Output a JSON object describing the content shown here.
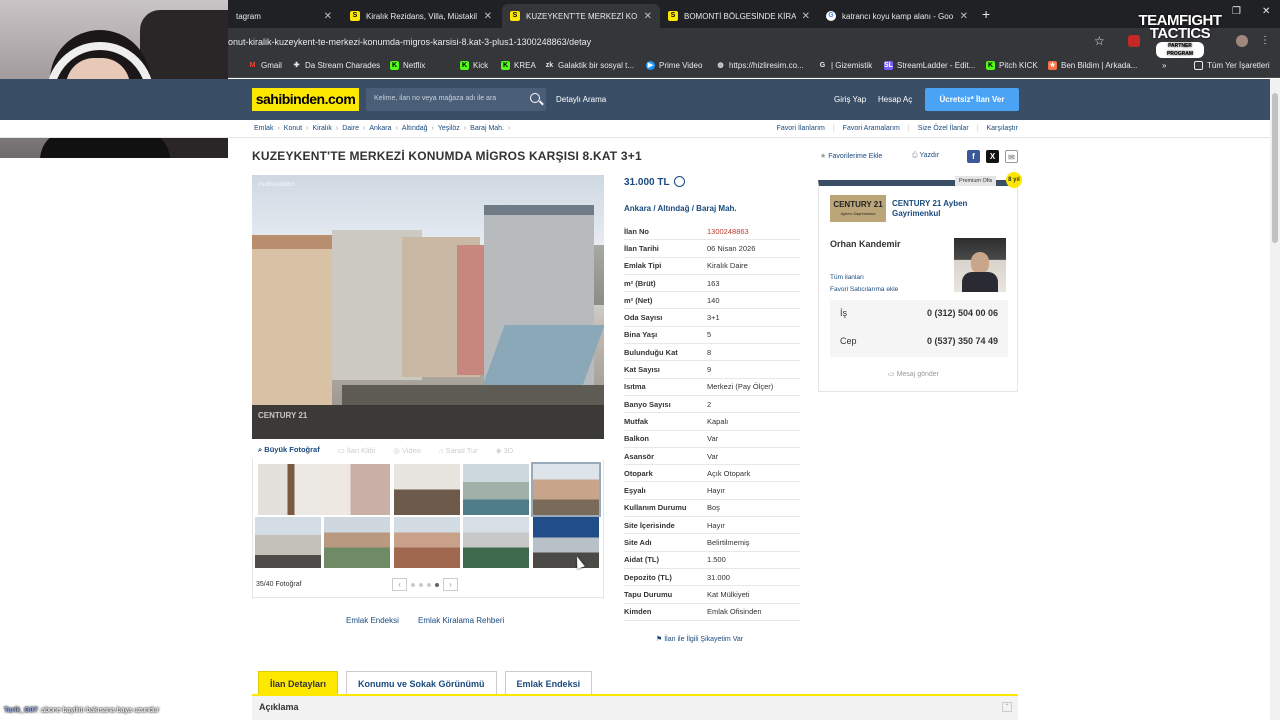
{
  "browser": {
    "tabs": [
      {
        "title": "tagram",
        "icon": "instagram-icon",
        "active": false
      },
      {
        "title": "Kiralık Rezidans, Villa, Müstakil",
        "icon": "sahibinden-icon",
        "active": false
      },
      {
        "title": "KUZEYKENT'TE MERKEZİ KONU",
        "icon": "sahibinden-icon",
        "active": true
      },
      {
        "title": "BOMONTİ BÖLGESİNDE KİRALI",
        "icon": "sahibinden-icon",
        "active": false
      },
      {
        "title": "katrancı koyu kamp alanı - Goo",
        "icon": "google-icon",
        "active": false
      }
    ],
    "new_tab": "+",
    "url": "onut-kiralik-kuzeykent-te-merkezi-konumda-migros-karsisi-8.kat-3-plus1-1300248863/detay",
    "bookmarks": [
      {
        "label": "Gmail",
        "icon": "gmail-icon",
        "color": "#ea4335"
      },
      {
        "label": "Da Stream Charades",
        "icon": "puzzle-icon",
        "color": "#e8eaed"
      },
      {
        "label": "Netflix",
        "icon": "kick-icon",
        "color": "#53fc18"
      },
      {
        "label": "Kick",
        "icon": "kick-icon",
        "color": "#53fc18"
      },
      {
        "label": "KREA",
        "icon": "kick-icon",
        "color": "#53fc18"
      },
      {
        "label": "Galaktik bir sosyal t...",
        "icon": "zk-icon",
        "color": "#e8eaed"
      },
      {
        "label": "Prime Video",
        "icon": "play-icon",
        "color": "#1a98ff"
      },
      {
        "label": "https://hizliresim.co...",
        "icon": "globe-icon",
        "color": "#e8eaed"
      },
      {
        "label": "| Gizemistik",
        "icon": "google-icon",
        "color": "#e8eaed"
      },
      {
        "label": "StreamLadder - Edit...",
        "icon": "streamladder-icon",
        "color": "#7b5cff"
      },
      {
        "label": "Pitch KICK",
        "icon": "kick-icon",
        "color": "#53fc18"
      },
      {
        "label": "Ben Bildim | Arkada...",
        "icon": "game-icon",
        "color": "#ff7043"
      }
    ],
    "more_bookmarks": "»",
    "all_bookmarks": "Tüm Yer İşaretleri"
  },
  "overlay": {
    "brand_line1": "TEAMFIGHT",
    "brand_line2": "TACTICS",
    "brand_sub": "PARTNER PROGRAM",
    "chat_user": "Tarik_G07",
    "chat_msg": ": abone bayiliıtı bakısana baya uzundur"
  },
  "site": {
    "logo": "sahibinden.com",
    "search_placeholder": "Kelime, ilan no veya mağaza adı ile ara",
    "advanced_search": "Detaylı Arama",
    "login": "Giriş Yap",
    "register": "Hesap Aç",
    "post_ad": "Ücretsiz* İlan Ver",
    "breadcrumbs": [
      "Emlak",
      "Konut",
      "Kiralık",
      "Daire",
      "Ankara",
      "Altındağ",
      "Yeşilöz",
      "Baraj Mah."
    ],
    "right_links": [
      "Favori İlanlarım",
      "Favori Aramalarım",
      "Size Özel İlanlar",
      "Karşılaştır"
    ]
  },
  "listing": {
    "title": "KUZEYKENT'TE MERKEZİ KONUMDA MİGROS KARŞISI 8.KAT 3+1",
    "add_favorite": "Favorilerime Ekle",
    "print": "Yazdır",
    "photo_listing_no": "#1300248863",
    "photo_watermark": "CENTURY 21",
    "photo_tools": [
      "Büyük Fotoğraf",
      "İlan Klibi",
      "Video",
      "Sanal Tur",
      "3D"
    ],
    "photo_count": "35/40 Fotoğraf",
    "bottom_links": [
      "Emlak Endeksi",
      "Emlak Kiralama Rehberi"
    ],
    "price": "31.000 TL",
    "location": [
      "Ankara",
      "Altındağ",
      "Baraj Mah."
    ],
    "details": [
      {
        "k": "İlan No",
        "v": "1300248863"
      },
      {
        "k": "İlan Tarihi",
        "v": "06 Nisan 2026"
      },
      {
        "k": "Emlak Tipi",
        "v": "Kiralık Daire"
      },
      {
        "k": "m² (Brüt)",
        "v": "163"
      },
      {
        "k": "m² (Net)",
        "v": "140"
      },
      {
        "k": "Oda Sayısı",
        "v": "3+1"
      },
      {
        "k": "Bina Yaşı",
        "v": "5"
      },
      {
        "k": "Bulunduğu Kat",
        "v": "8"
      },
      {
        "k": "Kat Sayısı",
        "v": "9"
      },
      {
        "k": "Isıtma",
        "v": "Merkezi (Pay Ölçer)"
      },
      {
        "k": "Banyo Sayısı",
        "v": "2"
      },
      {
        "k": "Mutfak",
        "v": "Kapalı"
      },
      {
        "k": "Balkon",
        "v": "Var"
      },
      {
        "k": "Asansör",
        "v": "Var"
      },
      {
        "k": "Otopark",
        "v": "Açık Otopark"
      },
      {
        "k": "Eşyalı",
        "v": "Hayır"
      },
      {
        "k": "Kullanım Durumu",
        "v": "Boş"
      },
      {
        "k": "Site İçerisinde",
        "v": "Hayır"
      },
      {
        "k": "Site Adı",
        "v": "Belirtilmemiş"
      },
      {
        "k": "Aidat (TL)",
        "v": "1.500"
      },
      {
        "k": "Depozito (TL)",
        "v": "31.000"
      },
      {
        "k": "Tapu Durumu",
        "v": "Kat Mülkiyeti"
      },
      {
        "k": "Kimden",
        "v": "Emlak Ofisinden"
      }
    ],
    "complaint": "İlan ile İlgili Şikayetim Var"
  },
  "seller": {
    "premium": "Premium Ofis",
    "badge": "8 yıl",
    "logo_main": "CENTURY 21",
    "logo_sub": "Ayben Gayrimenkul",
    "office": "CENTURY 21 Ayben Gayrimenkul",
    "agent": "Orhan Kandemir",
    "all_listings": "Tüm ilanları",
    "add_favorite_seller": "Favori Satıcılarıma ekle",
    "phones": [
      {
        "label": "İş",
        "number": "0 (312) 504 00 06"
      },
      {
        "label": "Cep",
        "number": "0 (537) 350 74 49"
      }
    ],
    "send_message": "Mesaj gönder"
  },
  "detail_tabs": [
    "İlan Detayları",
    "Konumu ve Sokak Görünümü",
    "Emlak Endeksi"
  ],
  "description_title": "Açıklama",
  "colors": {
    "brand_yellow": "#ffe800",
    "header_blue": "#3a4e66",
    "link_blue": "#1a4a7e",
    "cta_blue": "#4ba3f5"
  }
}
